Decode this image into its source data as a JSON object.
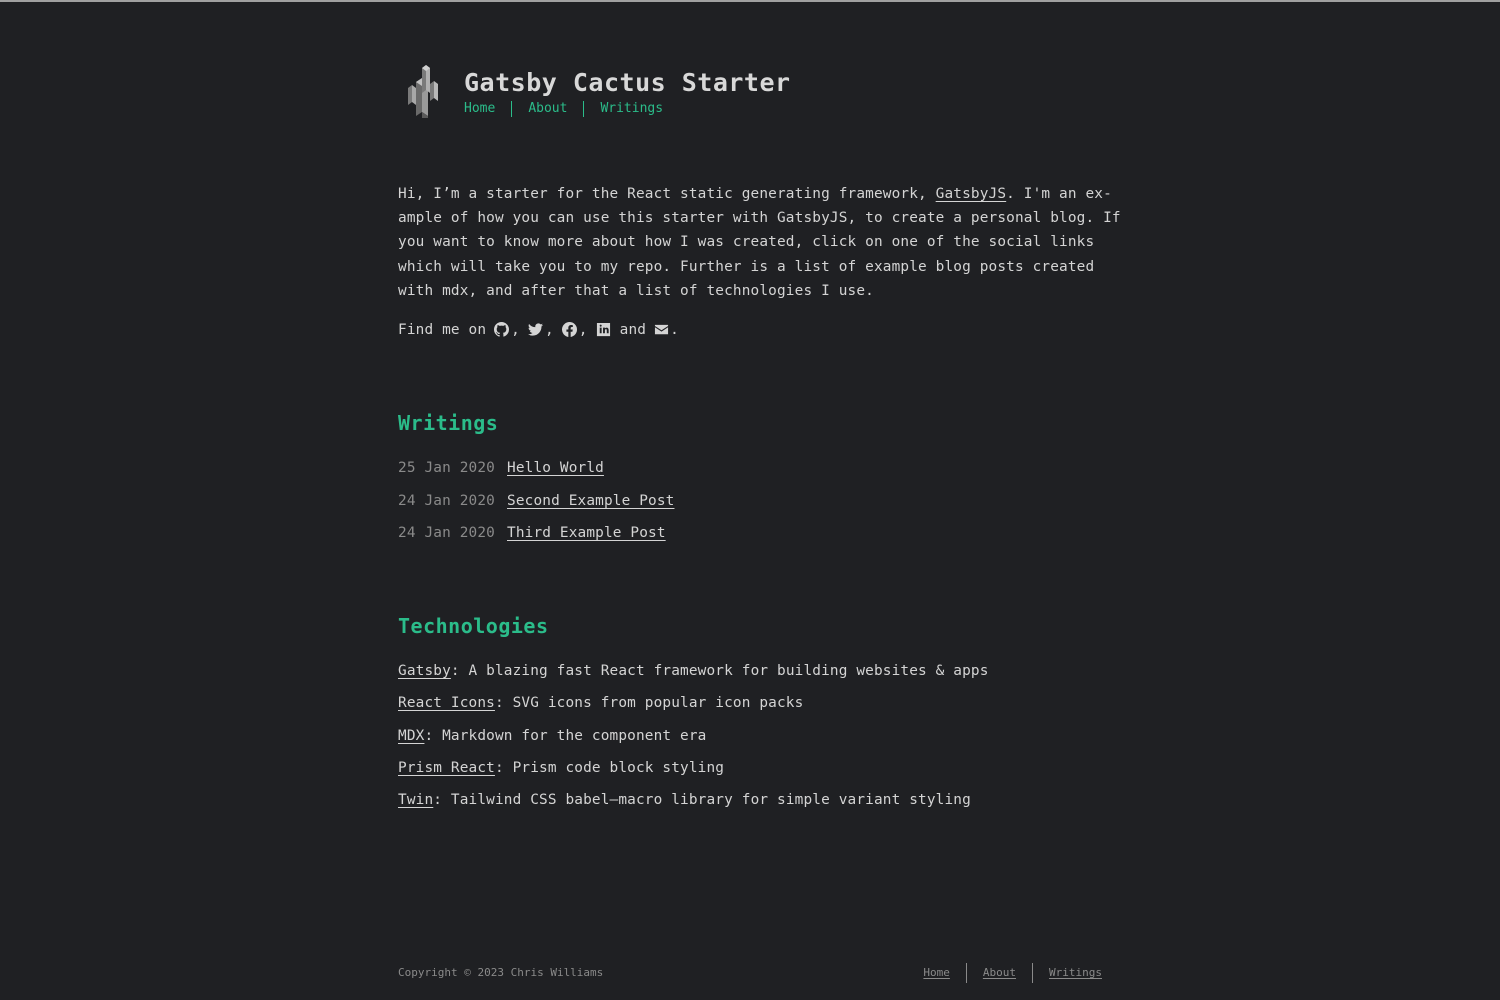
{
  "site": {
    "title": "Gatsby Cactus Starter",
    "nav": [
      {
        "label": "Home"
      },
      {
        "label": "About"
      },
      {
        "label": "Writings"
      }
    ]
  },
  "intro": {
    "line1_pre": "Hi, I’m a starter for the React static generating framework, ",
    "line1_link": "GatsbyJS",
    "line1_post": ". I'm an ex-",
    "line2": "ample of how you can use this starter with GatsbyJS, to create a personal blog. If",
    "line3": "you want to know more about how I was created, click on one of the social links",
    "line4": "which will take you to my repo. Further is a list of example blog posts created",
    "line5": "with mdx, and after that a list of technologies I use.",
    "find_me": "Find me on",
    "comma": ",",
    "and": "and",
    "period": ".",
    "icons": [
      "github-icon",
      "twitter-icon",
      "facebook-icon",
      "linkedin-icon",
      "mail-icon"
    ]
  },
  "writings": {
    "heading": "Writings",
    "posts": [
      {
        "date": "25 Jan 2020",
        "title": "Hello World"
      },
      {
        "date": "24 Jan 2020",
        "title": "Second Example Post"
      },
      {
        "date": "24 Jan 2020",
        "title": "Third Example Post"
      }
    ]
  },
  "technologies": {
    "heading": "Technologies",
    "items": [
      {
        "name": "Gatsby",
        "desc": ": A blazing fast React framework for building websites & apps"
      },
      {
        "name": "React Icons",
        "desc": ": SVG icons from popular icon packs"
      },
      {
        "name": "MDX",
        "desc": ": Markdown for the component era"
      },
      {
        "name": "Prism React",
        "desc": ": Prism code block styling"
      },
      {
        "name": "Twin",
        "desc": ": Tailwind CSS babel—macro library for simple variant styling"
      }
    ]
  },
  "footer": {
    "copyright": "Copyright © 2023 Chris Williams",
    "nav": [
      {
        "label": "Home"
      },
      {
        "label": "About"
      },
      {
        "label": "Writings"
      }
    ]
  },
  "colors": {
    "background": "#1f2023",
    "accent": "#2bbc8a",
    "text": "#d4d4d4",
    "muted": "#8a8a8a"
  }
}
